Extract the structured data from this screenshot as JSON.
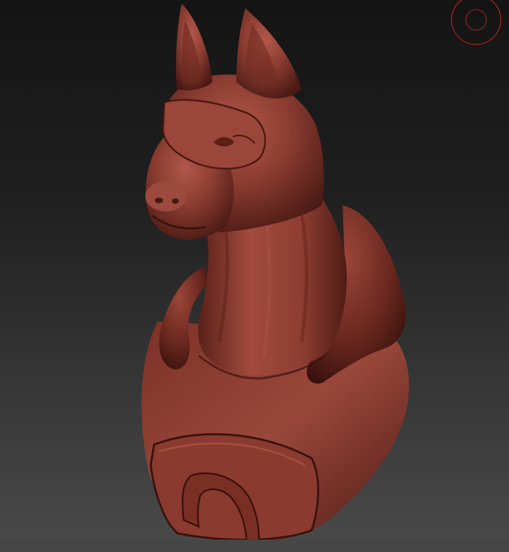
{
  "app": {
    "canvas_background": "#1f1f1f",
    "model_color": "#8a3a2e",
    "gizmo_color": "#b3231d"
  },
  "viewport": {
    "object": "sculpted-dog-bust",
    "gizmo_icon": "target-circle-icon"
  }
}
